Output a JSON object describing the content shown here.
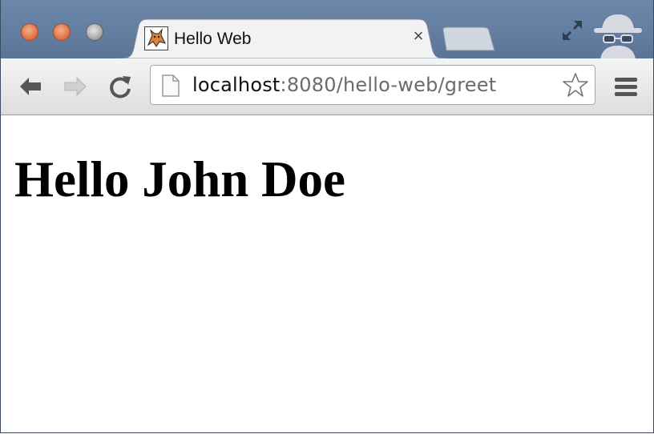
{
  "tab": {
    "title": "Hello Web",
    "close_label": "×"
  },
  "omnibox": {
    "url_host": "localhost",
    "url_rest": ":8080/hello-web/greet"
  },
  "page": {
    "heading": "Hello John Doe"
  },
  "icons": [
    "back-arrow-icon",
    "forward-arrow-icon",
    "reload-icon",
    "page-icon",
    "star-icon",
    "menu-icon",
    "fullscreen-icon",
    "incognito-icon",
    "tomcat-favicon"
  ],
  "colors": {
    "titlebar": "#6480a3",
    "close_button": "#d9683a",
    "toolbar": "#e8e8e8"
  }
}
